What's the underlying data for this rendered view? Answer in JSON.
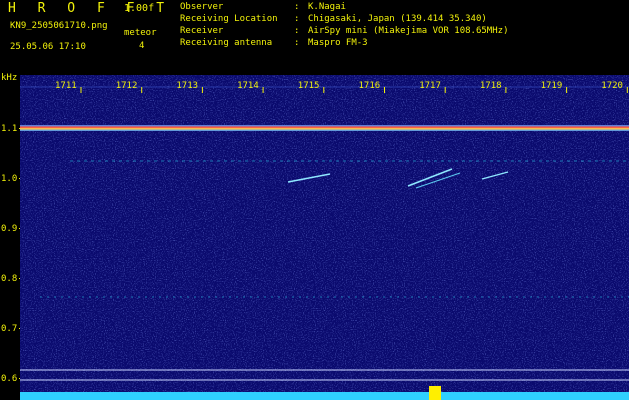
{
  "header": {
    "title": "H R O F F T",
    "version": "1.00f",
    "filename": "KN9_2505061710.png",
    "meteor_label": "meteor",
    "meteor_count": "4",
    "datetime": "25.05.06 17:10"
  },
  "info": [
    {
      "key": "Observer",
      "value": "K.Nagai"
    },
    {
      "key": "Receiving Location",
      "value": "Chigasaki, Japan (139.414 35.340)"
    },
    {
      "key": "Receiver",
      "value": "AirSpy mini (Miakejima VOR 108.65MHz)"
    },
    {
      "key": "Receiving antenna",
      "value": "Maspro FM-3"
    }
  ],
  "axis": {
    "y_unit": "kHz",
    "x_ticks": [
      "1711",
      "1712",
      "1713",
      "1714",
      "1715",
      "1716",
      "1717",
      "1718",
      "1719",
      "1720"
    ],
    "y_ticks": [
      "1.1",
      "1.0",
      "0.9",
      "0.8",
      "0.7",
      "0.6"
    ]
  },
  "colors": {
    "label": "#f2f20a",
    "background": "#0a0a6e",
    "carrier": "#ff4a3a",
    "meteor_trace": "#8fe8ff",
    "power_bar": "#2fd0ff",
    "power_peak": "#ffef00"
  }
}
